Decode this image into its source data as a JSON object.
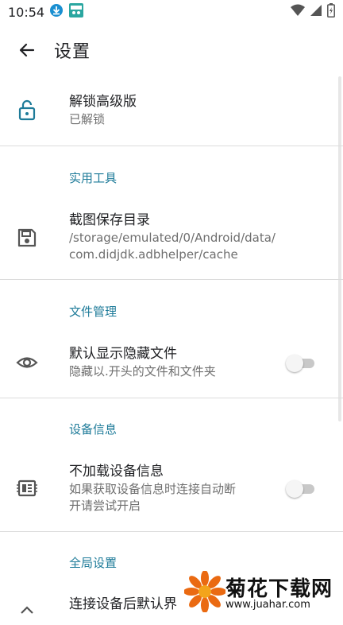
{
  "status_bar": {
    "time": "10:54",
    "icons": [
      "download-icon",
      "app-notification-icon",
      "wifi-icon",
      "signal-icon",
      "battery-icon"
    ]
  },
  "header": {
    "title": "设置",
    "back_icon": "arrow-back-icon"
  },
  "prefs": {
    "unlock": {
      "icon": "lock-open-icon",
      "title": "解锁高级版",
      "summary": "已解锁"
    },
    "cat_tools": "实用工具",
    "screenshot_dir": {
      "icon": "save-icon",
      "title": "截图保存目录",
      "summary_line1": "/storage/emulated/0/Android/data/",
      "summary_line2": "com.didjdk.adbhelper/cache"
    },
    "cat_files": "文件管理",
    "hidden_files": {
      "icon": "eye-icon",
      "title": "默认显示隐藏文件",
      "summary": "隐藏以.开头的文件和文件夹",
      "enabled": false
    },
    "cat_device": "设备信息",
    "device_info": {
      "icon": "chip-icon",
      "title": "不加载设备信息",
      "summary_line1": "如果获取设备信息时连接自动断",
      "summary_line2": "开请尝试开启",
      "enabled": false
    },
    "cat_global": "全局设置",
    "default_screen": {
      "icon": "chevron-up-icon",
      "title": "连接设备后默认界"
    }
  },
  "watermark": {
    "brand": "菊花下载网",
    "url": "www.juahar.com"
  },
  "colors": {
    "accent": "#1e7b99",
    "icon": "#555555",
    "lock_icon": "#1e7b99"
  }
}
